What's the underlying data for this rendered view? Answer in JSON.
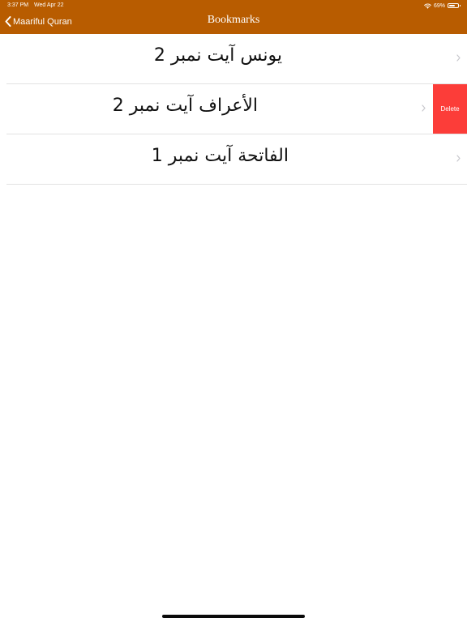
{
  "status_bar": {
    "time": "3:37 PM",
    "date": "Wed Apr 22",
    "battery_percent": "69%",
    "battery_level": 0.69,
    "wifi_icon": "wifi-icon",
    "battery_icon": "battery-icon"
  },
  "nav": {
    "back_label": "Maariful Quran",
    "back_icon": "chevron-left-icon",
    "title": "Bookmarks",
    "bar_color": "#b85c00"
  },
  "bookmarks": [
    {
      "label": "یونس آیت نمبر 2"
    },
    {
      "label": "الأعراف آیت نمبر 2",
      "action_label": "Delete"
    },
    {
      "label": "الفاتحة آیت نمبر 1"
    }
  ],
  "colors": {
    "delete": "#fc3d39",
    "separator": "#e2e2e2",
    "chevron": "#c7c7cc"
  }
}
